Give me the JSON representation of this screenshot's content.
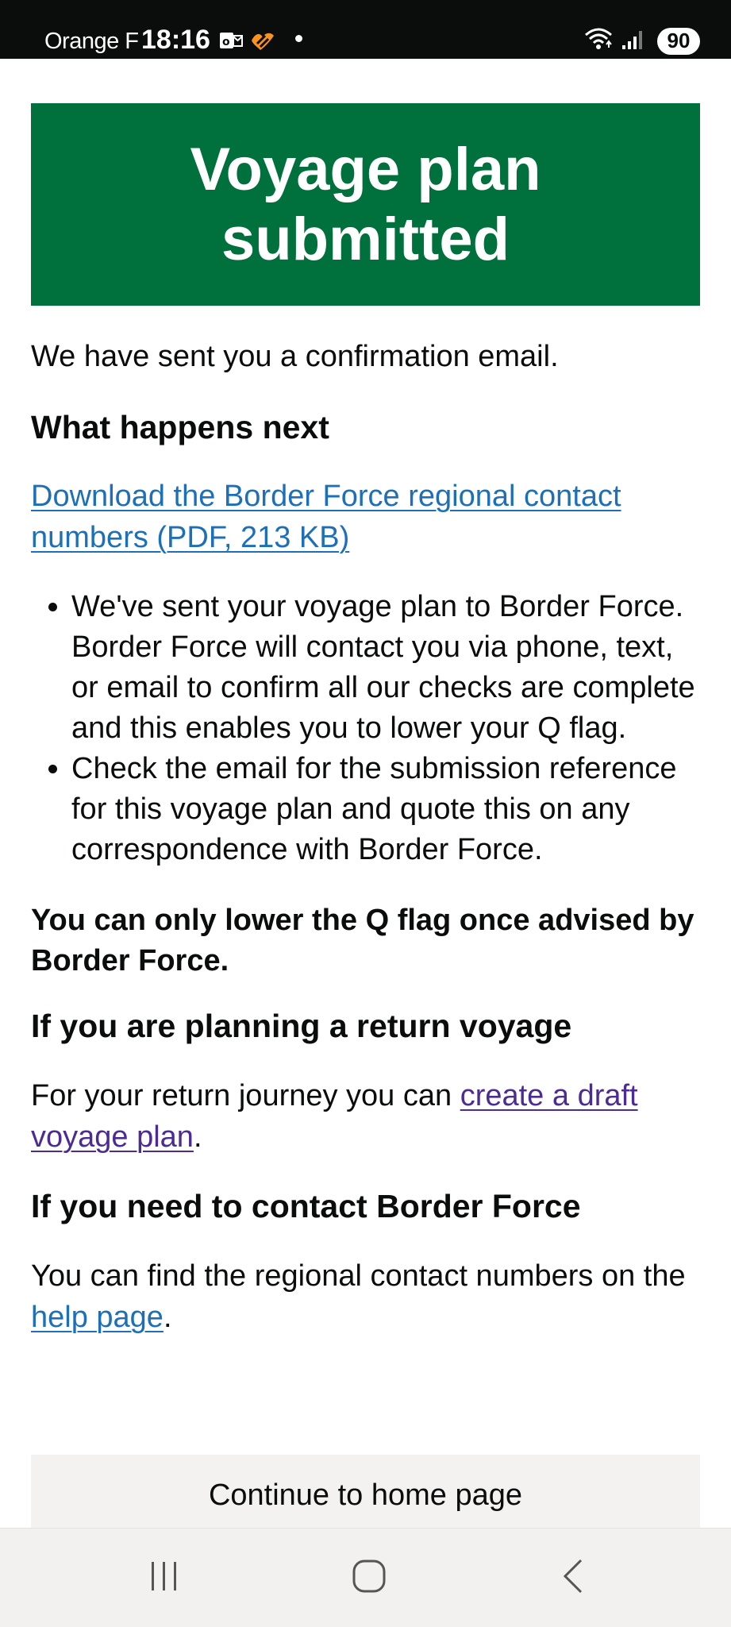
{
  "status_bar": {
    "carrier": "Orange F",
    "time": "18:16",
    "battery": "90",
    "notification_icons": [
      "outlook-icon",
      "deezer-icon"
    ],
    "system_icons": [
      "wifi-icon",
      "signal-icon"
    ]
  },
  "confirmation_panel": {
    "title": "Voyage plan submitted"
  },
  "main": {
    "email_sent": "We have sent you a confirmation email.",
    "what_next_heading": "What happens next",
    "download_link": "Download the Border Force regional contact numbers (PDF, 213 KB)",
    "bullets": [
      "We've sent your voyage plan to Border Force. Border Force will contact you via phone, text, or email to confirm all our checks are complete and this enables you to lower your Q flag.",
      "Check the email for the submission reference for this voyage plan and quote this on any correspondence with Border Force."
    ],
    "warning": "You can only lower the Q flag once advised by Border Force.",
    "return_heading": "If you are planning a return voyage",
    "return_text": "For your return journey you can ",
    "return_link": "create a draft voyage plan",
    "return_end": ".",
    "contact_heading": "If you need to contact Border Force",
    "contact_text": "You can find the regional contact numbers on the ",
    "contact_link": "help page",
    "contact_end": "."
  },
  "continue_button": {
    "label": "Continue to home page"
  },
  "nav_bar": {
    "buttons": [
      "recents-icon",
      "home-icon",
      "back-icon"
    ]
  },
  "colors": {
    "panel_green": "#00703c",
    "link_blue": "#1d70b8",
    "visited_link_purple": "#4c2c92",
    "button_grey": "#f3f2f1"
  }
}
